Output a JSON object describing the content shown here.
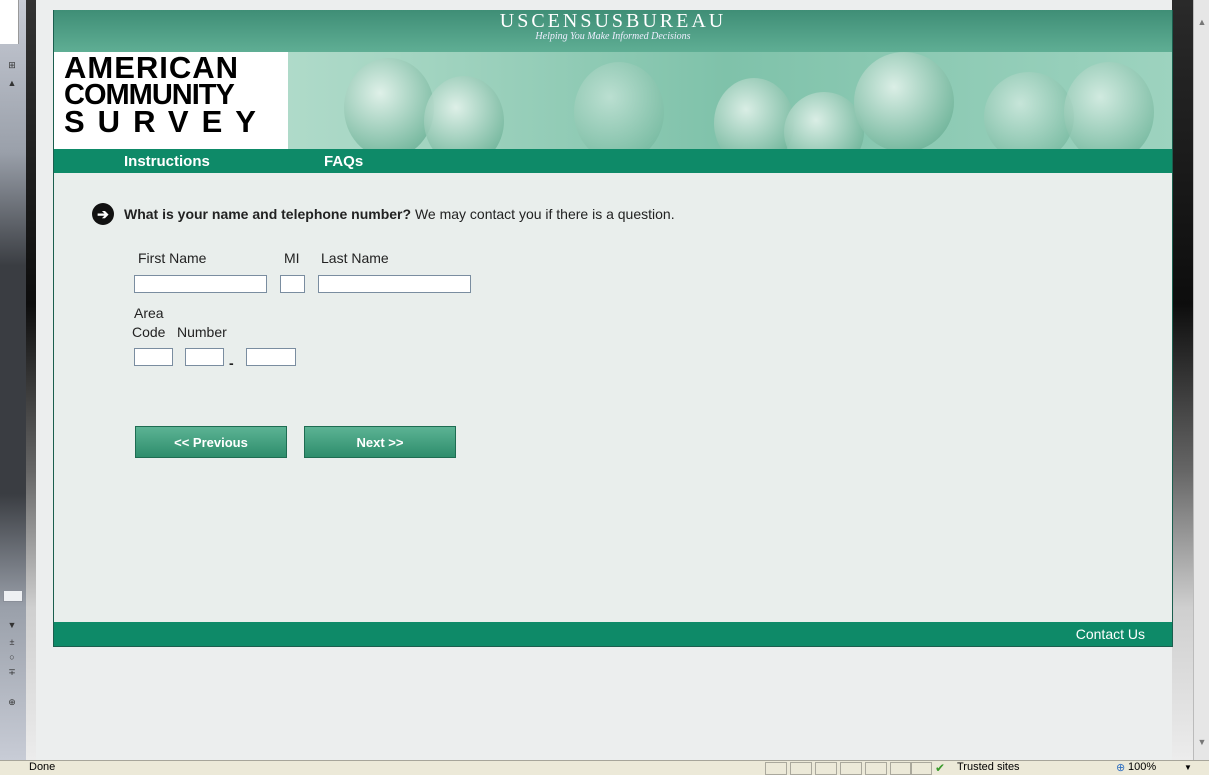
{
  "header": {
    "bureau_title": "USCENSUSBUREAU",
    "tagline": "Helping You Make Informed Decisions"
  },
  "logo": {
    "line1": "AMERICAN",
    "line2": "COMMUNITY",
    "line3": "SURVEY"
  },
  "nav": {
    "instructions": "Instructions",
    "faqs": "FAQs"
  },
  "question": {
    "icon": "arrow-right-circle-icon",
    "bold_text": "What is your name and telephone number?",
    "plain_text": "We may contact you if there is a question."
  },
  "form": {
    "first_name_label": "First Name",
    "mi_label": "MI",
    "last_name_label": "Last Name",
    "area_label_1": "Area",
    "area_label_2": "Code",
    "number_label": "Number",
    "dash": "-",
    "first_name_value": "",
    "mi_value": "",
    "last_name_value": "",
    "area_code_value": "",
    "number_prefix_value": "",
    "number_suffix_value": ""
  },
  "buttons": {
    "previous": "<<  Previous",
    "next": "Next  >>"
  },
  "footer": {
    "contact": "Contact Us"
  },
  "statusbar": {
    "text": "Done",
    "zone": "Trusted sites",
    "zoom": "100%"
  },
  "colors": {
    "nav_green": "#0e8a68",
    "header_green": "#3f8e76",
    "button_green": "#2e8d6c"
  }
}
